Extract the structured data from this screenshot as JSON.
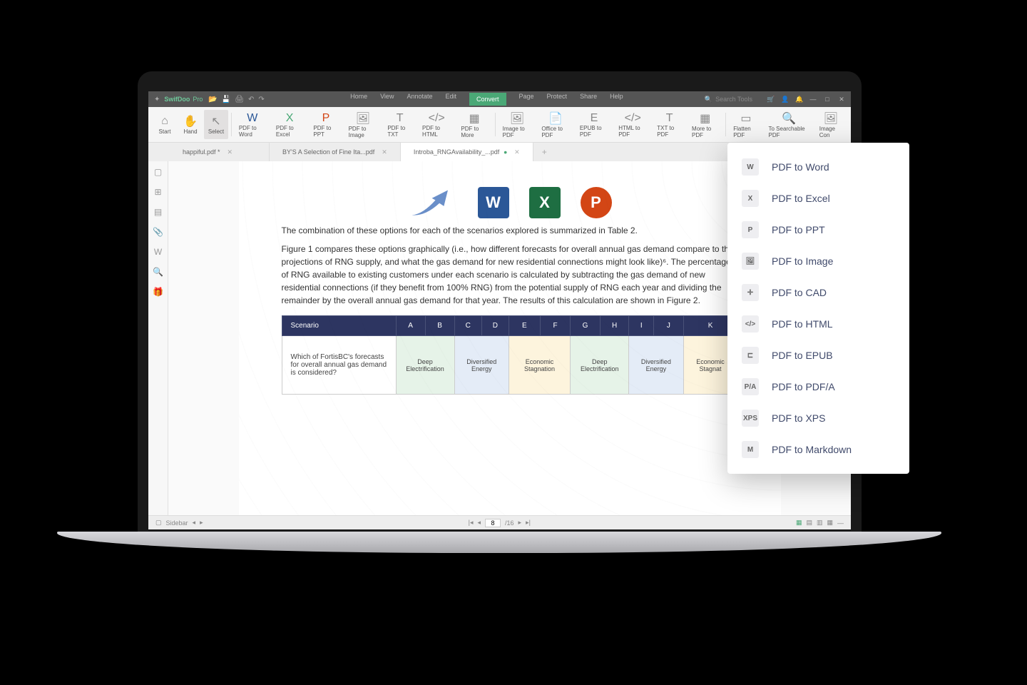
{
  "titlebar": {
    "app": "SwifDoo",
    "edition": "Pro",
    "menu": [
      "Home",
      "View",
      "Annotate",
      "Edit",
      "Convert",
      "Page",
      "Protect",
      "Share",
      "Help"
    ],
    "active_menu": "Convert",
    "search_placeholder": "Search Tools"
  },
  "ribbon": {
    "groups": [
      [
        {
          "l": "Start",
          "i": "⌂"
        },
        {
          "l": "Hand",
          "i": "✋"
        },
        {
          "l": "Select",
          "i": "↖",
          "active": true
        }
      ],
      [
        {
          "l": "PDF to Word",
          "i": "W",
          "c": "b"
        },
        {
          "l": "PDF to Excel",
          "i": "X",
          "c": "g"
        },
        {
          "l": "PDF to PPT",
          "i": "P",
          "c": "o"
        },
        {
          "l": "PDF to Image",
          "i": "🖼"
        },
        {
          "l": "PDF to TXT",
          "i": "T"
        },
        {
          "l": "PDF to HTML",
          "i": "</>"
        },
        {
          "l": "PDF to More",
          "i": "▦"
        }
      ],
      [
        {
          "l": "Image to PDF",
          "i": "🖼"
        },
        {
          "l": "Office to PDF",
          "i": "📄"
        },
        {
          "l": "EPUB to PDF",
          "i": "E"
        },
        {
          "l": "HTML to PDF",
          "i": "</>"
        },
        {
          "l": "TXT to PDF",
          "i": "T"
        },
        {
          "l": "More to PDF",
          "i": "▦"
        }
      ],
      [
        {
          "l": "Flatten PDF",
          "i": "▭"
        },
        {
          "l": "To Searchable PDF",
          "i": "🔍"
        },
        {
          "l": "Image Con",
          "i": "🖼"
        }
      ]
    ]
  },
  "tabs": {
    "items": [
      {
        "name": "happiful.pdf *",
        "active": false
      },
      {
        "name": "BY'S A Selection of Fine Ita...pdf",
        "active": false
      },
      {
        "name": "Introba_RNGAvailability_...pdf",
        "active": true
      }
    ]
  },
  "document": {
    "para1": "The combination of these options for each of the scenarios explored is summarized in Table 2.",
    "para2": "Figure 1 compares these options graphically (i.e., how different forecasts for overall annual gas demand compare to the projections of RNG supply, and what the gas demand for new residential connections might look like)⁶. The percentage of RNG available to existing customers under each scenario is calculated by subtracting the gas demand of new residential connections (if they benefit from 100% RNG) from the potential supply of RNG each year and dividing the remainder by the overall annual gas demand for that year. The results of this calculation are shown in Figure 2.",
    "table": {
      "header": [
        "Scenario",
        "A",
        "B",
        "C",
        "D",
        "E",
        "F",
        "G",
        "H",
        "I",
        "J",
        "K"
      ],
      "row_q": "Which of FortisBC's forecasts for overall annual gas demand is considered?",
      "cells": [
        {
          "t": "Deep Electrification",
          "c": "g",
          "span": 2
        },
        {
          "t": "Diversified Energy",
          "c": "b",
          "span": 2
        },
        {
          "t": "Economic Stagnation",
          "c": "y",
          "span": 2
        },
        {
          "t": "Deep Electrification",
          "c": "g",
          "span": 2
        },
        {
          "t": "Diversified Energy",
          "c": "b",
          "span": 2
        },
        {
          "t": "Economic Stagnat",
          "c": "y",
          "span": 1
        }
      ]
    }
  },
  "bottomnav": {
    "sidebar_label": "Sidebar",
    "page_current": "8",
    "page_total": "/16"
  },
  "float": {
    "items": [
      {
        "ico": "W",
        "label": "PDF to Word"
      },
      {
        "ico": "X",
        "label": "PDF to Excel"
      },
      {
        "ico": "P",
        "label": "PDF to PPT"
      },
      {
        "ico": "🖼",
        "label": "PDF to Image"
      },
      {
        "ico": "✛",
        "label": "PDF to CAD"
      },
      {
        "ico": "</>",
        "label": "PDF to HTML"
      },
      {
        "ico": "⊏",
        "label": "PDF to EPUB"
      },
      {
        "ico": "P/A",
        "label": "PDF to PDF/A"
      },
      {
        "ico": "XPS",
        "label": "PDF to XPS"
      },
      {
        "ico": "M",
        "label": "PDF to Markdown"
      }
    ]
  }
}
